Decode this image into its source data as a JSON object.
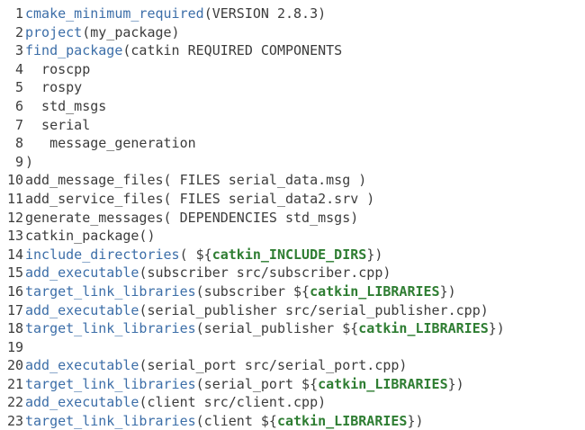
{
  "lines": [
    {
      "n": "1",
      "parts": [
        {
          "t": "cmake_minimum_required",
          "c": "kw"
        },
        {
          "t": "(VERSION 2.8.3)",
          "c": "plain"
        }
      ]
    },
    {
      "n": "2",
      "parts": [
        {
          "t": "project",
          "c": "kw"
        },
        {
          "t": "(my_package)",
          "c": "plain"
        }
      ]
    },
    {
      "n": "3",
      "parts": [
        {
          "t": "find_package",
          "c": "kw"
        },
        {
          "t": "(catkin REQUIRED COMPONENTS",
          "c": "plain"
        }
      ]
    },
    {
      "n": "4",
      "parts": [
        {
          "t": "  roscpp",
          "c": "plain"
        }
      ]
    },
    {
      "n": "5",
      "parts": [
        {
          "t": "  rospy",
          "c": "plain"
        }
      ]
    },
    {
      "n": "6",
      "parts": [
        {
          "t": "  std_msgs",
          "c": "plain"
        }
      ]
    },
    {
      "n": "7",
      "parts": [
        {
          "t": "  serial",
          "c": "plain"
        }
      ]
    },
    {
      "n": "8",
      "parts": [
        {
          "t": "   message_generation",
          "c": "plain"
        }
      ]
    },
    {
      "n": "9",
      "parts": [
        {
          "t": ")",
          "c": "plain"
        }
      ]
    },
    {
      "n": "10",
      "parts": [
        {
          "t": "add_message_files( FILES serial_data.msg )",
          "c": "plain"
        }
      ]
    },
    {
      "n": "11",
      "parts": [
        {
          "t": "add_service_files( FILES serial_data2.srv )",
          "c": "plain"
        }
      ]
    },
    {
      "n": "12",
      "parts": [
        {
          "t": "generate_messages( DEPENDENCIES std_msgs)",
          "c": "plain"
        }
      ]
    },
    {
      "n": "13",
      "parts": [
        {
          "t": "catkin_package()",
          "c": "plain"
        }
      ]
    },
    {
      "n": "14",
      "parts": [
        {
          "t": "include_directories",
          "c": "kw"
        },
        {
          "t": "( ${",
          "c": "plain"
        },
        {
          "t": "catkin_INCLUDE_DIRS",
          "c": "var"
        },
        {
          "t": "})",
          "c": "plain"
        }
      ]
    },
    {
      "n": "15",
      "parts": [
        {
          "t": "add_executable",
          "c": "kw"
        },
        {
          "t": "(subscriber src/subscriber.cpp)",
          "c": "plain"
        }
      ]
    },
    {
      "n": "16",
      "parts": [
        {
          "t": "target_link_libraries",
          "c": "kw"
        },
        {
          "t": "(subscriber ${",
          "c": "plain"
        },
        {
          "t": "catkin_LIBRARIES",
          "c": "var"
        },
        {
          "t": "})",
          "c": "plain"
        }
      ]
    },
    {
      "n": "17",
      "parts": [
        {
          "t": "add_executable",
          "c": "kw"
        },
        {
          "t": "(serial_publisher src/serial_publisher.cpp)",
          "c": "plain"
        }
      ]
    },
    {
      "n": "18",
      "parts": [
        {
          "t": "target_link_libraries",
          "c": "kw"
        },
        {
          "t": "(serial_publisher ${",
          "c": "plain"
        },
        {
          "t": "catkin_LIBRARIES",
          "c": "var"
        },
        {
          "t": "})",
          "c": "plain"
        }
      ]
    },
    {
      "n": "19",
      "parts": []
    },
    {
      "n": "20",
      "parts": [
        {
          "t": "add_executable",
          "c": "kw"
        },
        {
          "t": "(serial_port src/serial_port.cpp)",
          "c": "plain"
        }
      ]
    },
    {
      "n": "21",
      "parts": [
        {
          "t": "target_link_libraries",
          "c": "kw"
        },
        {
          "t": "(serial_port ${",
          "c": "plain"
        },
        {
          "t": "catkin_LIBRARIES",
          "c": "var"
        },
        {
          "t": "})",
          "c": "plain"
        }
      ]
    },
    {
      "n": "22",
      "parts": [
        {
          "t": "add_executable",
          "c": "kw"
        },
        {
          "t": "(client src/client.cpp)",
          "c": "plain"
        }
      ]
    },
    {
      "n": "23",
      "parts": [
        {
          "t": "target_link_libraries",
          "c": "kw"
        },
        {
          "t": "(client ${",
          "c": "plain"
        },
        {
          "t": "catkin_LIBRARIES",
          "c": "var"
        },
        {
          "t": "})",
          "c": "plain"
        }
      ]
    }
  ],
  "colors": {
    "keyword": "#3c6ea8",
    "variable": "#2e7d32",
    "text": "#3c3c3c",
    "background": "#ffffff"
  }
}
